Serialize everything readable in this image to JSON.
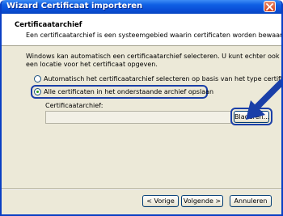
{
  "window": {
    "title": "Wizard Certificaat importeren"
  },
  "header": {
    "title": "Certificaatarchief",
    "subtitle": "Een certificaatarchief is een systeemgebied waarin certificaten worden bewaard."
  },
  "body": {
    "description_line1": "Windows kan automatisch een certificaatarchief selecteren. U kunt echter ook zelf",
    "description_line2": "een locatie voor het certificaat opgeven.",
    "option_auto": "Automatisch het certificaatarchief selecteren op basis van het type certificaat",
    "option_manual": "Alle certificaten in het onderstaande archief opslaan",
    "selected_option": "option_manual",
    "store_label": "Certificaatarchief:",
    "store_value": "",
    "browse_label": "Bladeren..."
  },
  "footer": {
    "back_label": "< Vorige",
    "next_label": "Volgende >",
    "cancel_label": "Annuleren"
  },
  "colors": {
    "titlebar": "#0a4fd8",
    "highlight": "#1a3fa8",
    "dialog_bg": "#ece9d8"
  },
  "icons": {
    "close": "close-icon",
    "annotation": "arrow-icon"
  }
}
